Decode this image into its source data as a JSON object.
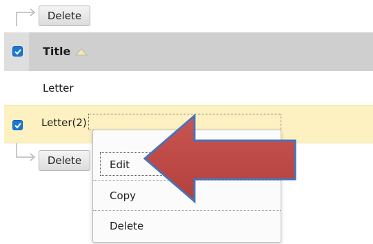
{
  "toolbar_top": {
    "delete_label": "Delete"
  },
  "table": {
    "header": {
      "title_label": "Title",
      "sort_icon": "sort-ascending-icon",
      "checked": true
    },
    "rows": [
      {
        "title": "Letter",
        "checked": false
      },
      {
        "title": "Letter(2)",
        "checked": true,
        "highlighted": true
      }
    ]
  },
  "toolbar_bottom": {
    "delete_label": "Delete"
  },
  "context_menu": {
    "items": [
      {
        "label": "Edit"
      },
      {
        "label": "Copy"
      },
      {
        "label": "Delete"
      }
    ]
  },
  "colors": {
    "header_bg": "#cfcfcf",
    "highlight_row": "#fdf1c2",
    "checkbox": "#1a78d4",
    "arrow_fill": "#c0504d",
    "arrow_stroke": "#4a72b8"
  }
}
